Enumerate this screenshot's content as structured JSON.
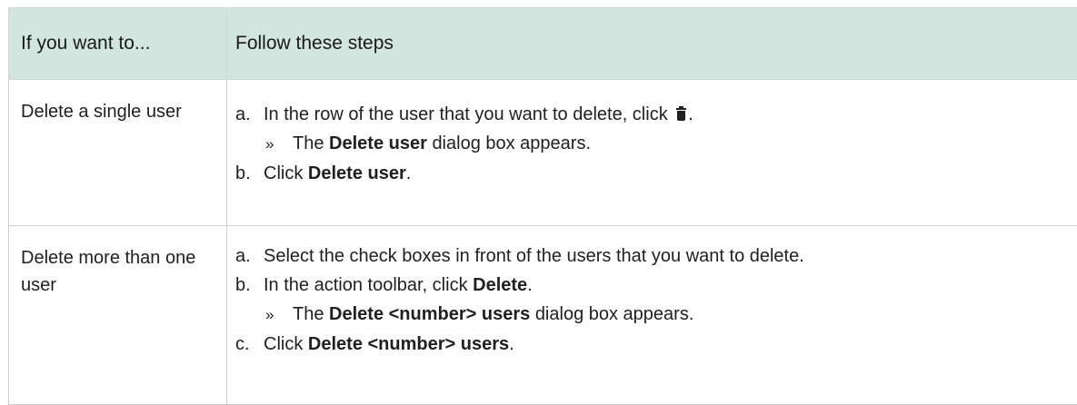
{
  "table": {
    "headers": [
      "If you want to...",
      "Follow these steps"
    ],
    "rows": [
      {
        "condition": "Delete a single user",
        "steps": [
          {
            "marker": "a.",
            "text_before": "In the row of the user that you want to delete, click",
            "icon": "trash-icon",
            "text_after": "."
          },
          {
            "result_marker": "»",
            "result_before": "The",
            "result_bold": "Delete user",
            "result_after": "dialog box appears."
          },
          {
            "marker": "b.",
            "text_before": "Click",
            "bold": "Delete user",
            "text_after": "."
          }
        ]
      },
      {
        "condition": "Delete more than one user",
        "steps": [
          {
            "marker": "a.",
            "text": "Select the check boxes in front of the users that you want to delete."
          },
          {
            "marker": "b.",
            "text_before": "In the action toolbar, click",
            "bold": "Delete",
            "text_after": "."
          },
          {
            "result_marker": "»",
            "result_before": "The",
            "result_bold": "Delete <number> users",
            "result_after": "dialog box appears."
          },
          {
            "marker": "c.",
            "text_before": "Click",
            "bold": "Delete <number> users",
            "text_after": "."
          }
        ]
      }
    ]
  },
  "colors": {
    "header_background": "#d3e5df",
    "text": "#1f1f1f",
    "border": "#cfcfcf"
  }
}
